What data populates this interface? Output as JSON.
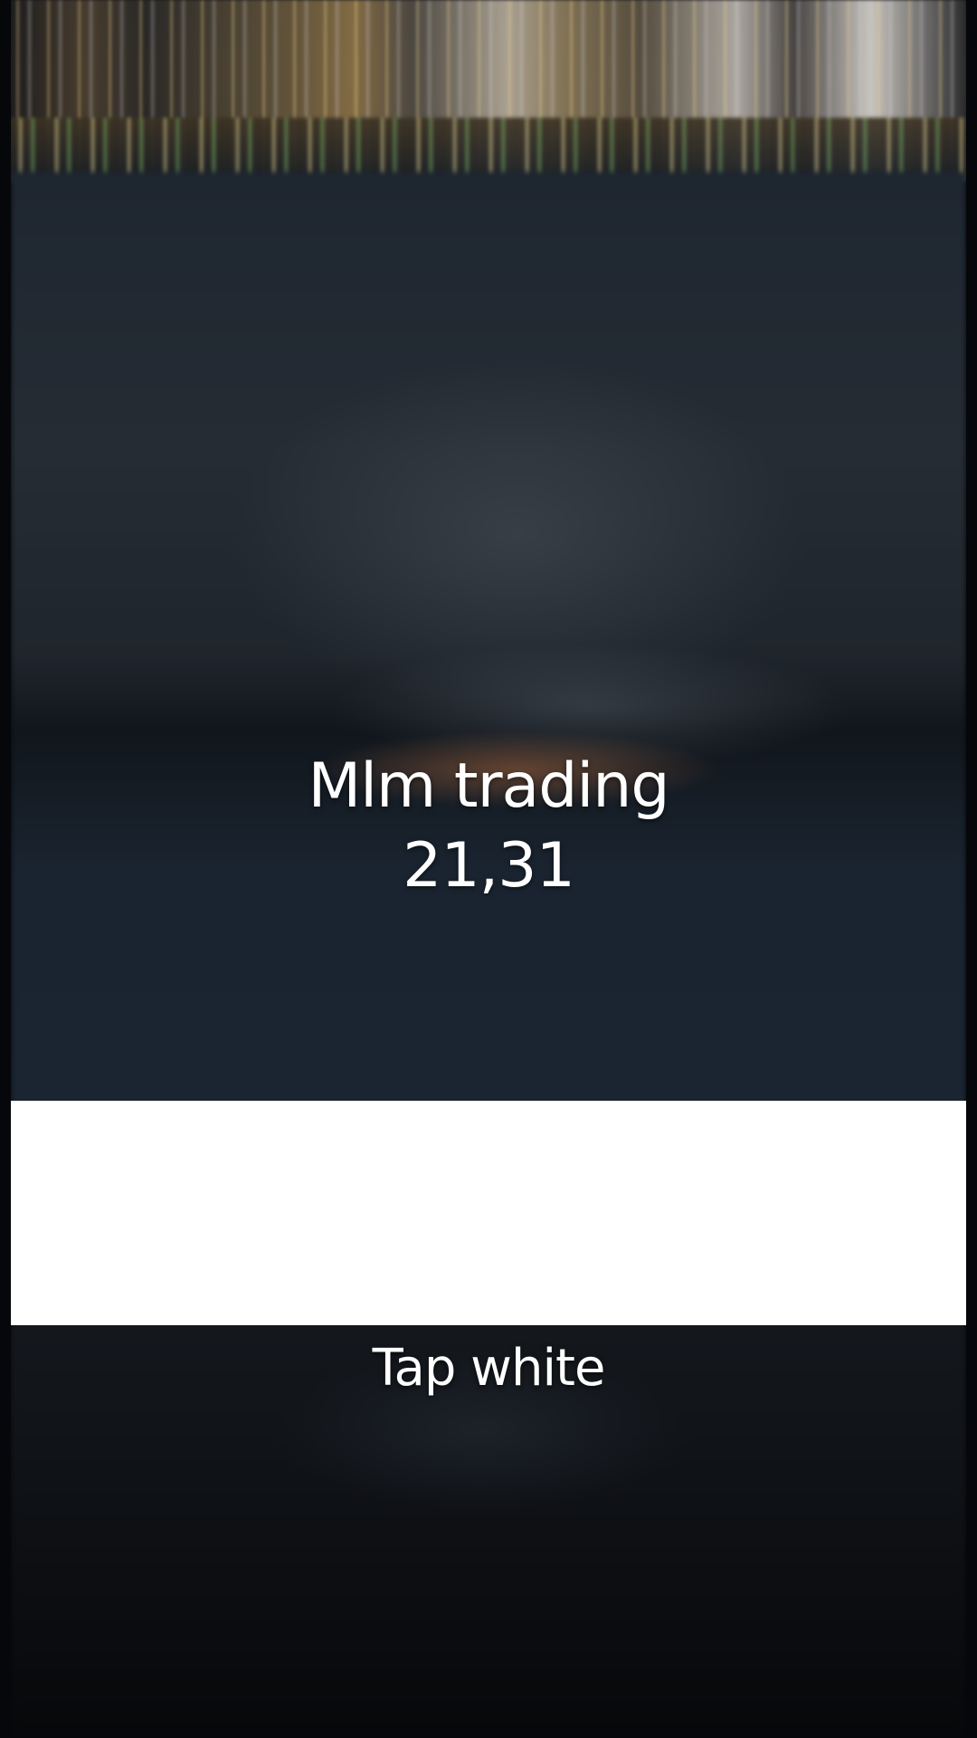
{
  "overlay": {
    "title_line1": "Mlm trading",
    "title_line2": "21,31",
    "caption": "Tap white"
  },
  "colors": {
    "panel": "#ffffff",
    "text": "#ffffff",
    "background": "#05070b"
  }
}
